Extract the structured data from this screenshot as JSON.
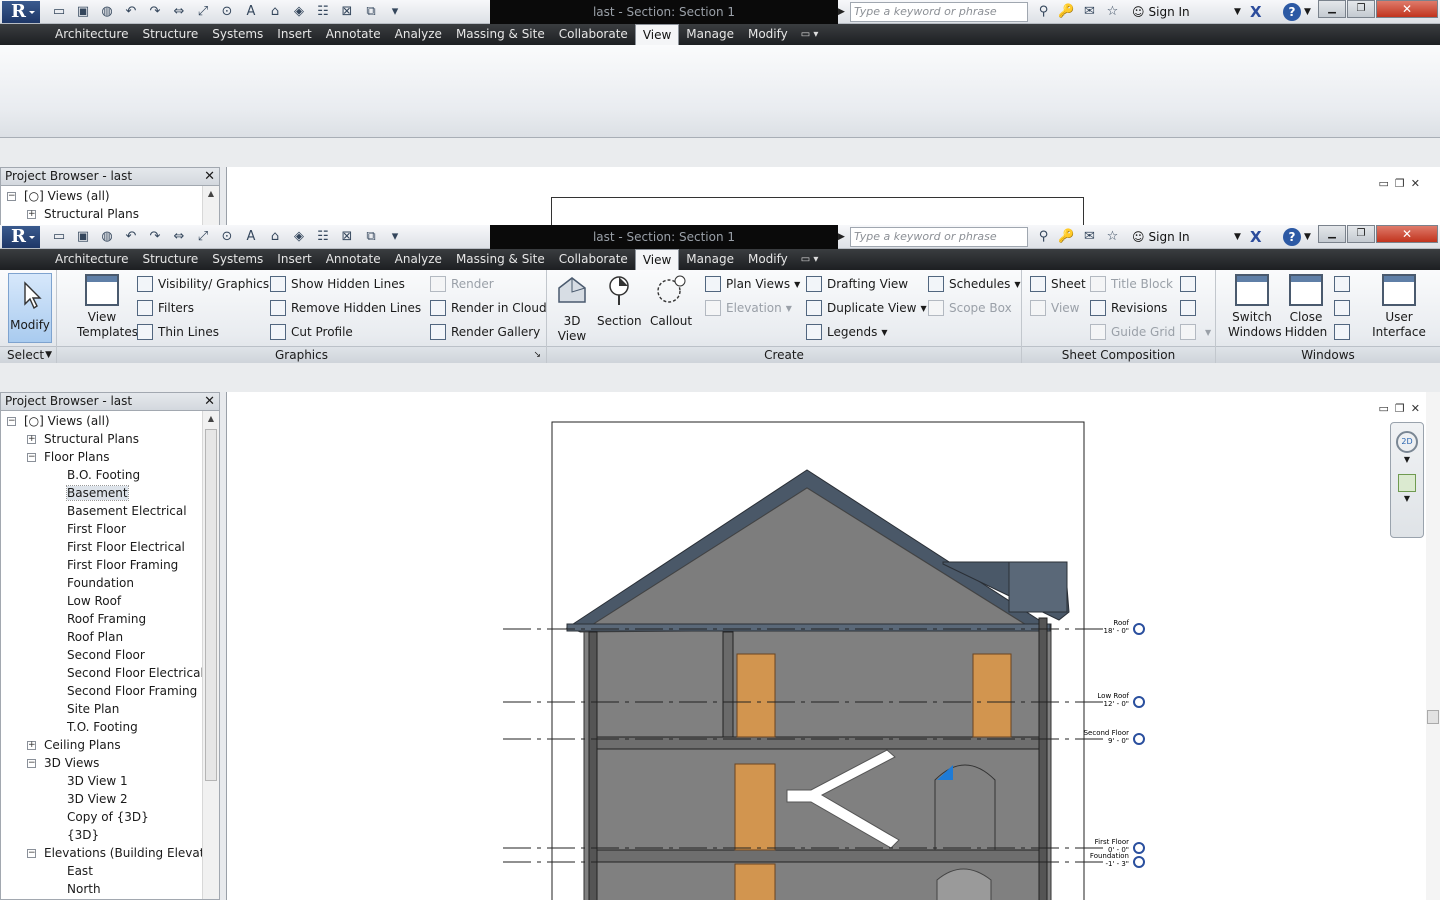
{
  "titlebar": {
    "title": "last - Section: Section 1",
    "search_placeholder": "Type a keyword or phrase",
    "sign_in": "Sign In"
  },
  "tabs": [
    "Architecture",
    "Structure",
    "Systems",
    "Insert",
    "Annotate",
    "Analyze",
    "Massing & Site",
    "Collaborate",
    "View",
    "Manage",
    "Modify"
  ],
  "active_tab": "View",
  "ribbon": {
    "modify": "Modify",
    "select": "Select",
    "graphics": {
      "label": "Graphics",
      "view_templates": "View Templates",
      "visibility": "Visibility/ Graphics",
      "filters": "Filters",
      "thin_lines": "Thin Lines",
      "show_hidden": "Show Hidden Lines",
      "remove_hidden": "Remove Hidden Lines",
      "cut_profile": "Cut Profile",
      "render": "Render",
      "render_cloud": "Render in Cloud",
      "render_gallery": "Render Gallery"
    },
    "create": {
      "label": "Create",
      "view_3d": "3D View",
      "section": "Section",
      "callout": "Callout",
      "plan_views": "Plan Views",
      "elevation": "Elevation",
      "drafting_view": "Drafting View",
      "duplicate_view": "Duplicate View",
      "legends": "Legends",
      "schedules": "Schedules",
      "scope_box": "Scope Box"
    },
    "sheet_composition": {
      "label": "Sheet Composition",
      "sheet": "Sheet",
      "view": "View",
      "title_block": "Title Block",
      "revisions": "Revisions",
      "guide_grid": "Guide Grid"
    },
    "windows": {
      "label": "Windows",
      "switch_windows": "Switch Windows",
      "close_hidden": "Close Hidden",
      "user_interface": "User Interface"
    }
  },
  "project_browser": {
    "title": "Project Browser - last",
    "selected": "Basement",
    "tree": [
      {
        "level": 0,
        "toggle": "-",
        "icon": true,
        "label": "Views (all)"
      },
      {
        "level": 1,
        "toggle": "+",
        "label": "Structural Plans"
      },
      {
        "level": 1,
        "toggle": "-",
        "label": "Floor Plans"
      },
      {
        "level": 2,
        "label": "B.O. Footing"
      },
      {
        "level": 2,
        "label": "Basement"
      },
      {
        "level": 2,
        "label": "Basement Electrical"
      },
      {
        "level": 2,
        "label": "First Floor"
      },
      {
        "level": 2,
        "label": "First Floor Electrical"
      },
      {
        "level": 2,
        "label": "First Floor Framing"
      },
      {
        "level": 2,
        "label": "Foundation"
      },
      {
        "level": 2,
        "label": "Low Roof"
      },
      {
        "level": 2,
        "label": "Roof Framing"
      },
      {
        "level": 2,
        "label": "Roof Plan"
      },
      {
        "level": 2,
        "label": "Second Floor"
      },
      {
        "level": 2,
        "label": "Second Floor Electrical"
      },
      {
        "level": 2,
        "label": "Second Floor Framing"
      },
      {
        "level": 2,
        "label": "Site Plan"
      },
      {
        "level": 2,
        "label": "T.O. Footing"
      },
      {
        "level": 1,
        "toggle": "+",
        "label": "Ceiling Plans"
      },
      {
        "level": 1,
        "toggle": "-",
        "label": "3D Views"
      },
      {
        "level": 2,
        "label": "3D View 1"
      },
      {
        "level": 2,
        "label": "3D View 2"
      },
      {
        "level": 2,
        "label": "Copy of {3D}"
      },
      {
        "level": 2,
        "label": "{3D}"
      },
      {
        "level": 1,
        "toggle": "-",
        "label": "Elevations (Building Elevation"
      },
      {
        "level": 2,
        "label": "East"
      },
      {
        "level": 2,
        "label": "North"
      }
    ]
  },
  "levels": [
    {
      "name": "Roof",
      "elev": "18' - 0\""
    },
    {
      "name": "Low Roof",
      "elev": "12' - 0\""
    },
    {
      "name": "Second Floor",
      "elev": "9' - 0\""
    },
    {
      "name": "First Floor",
      "elev": "0' - 0\""
    },
    {
      "name": "Foundation",
      "elev": "-1' - 3\""
    }
  ],
  "colors": {
    "roof": "#4a5868",
    "wall": "#808080",
    "door": "#d2954f",
    "tabbar": "#2b2d30",
    "level_marker": "#2a4f9e"
  }
}
